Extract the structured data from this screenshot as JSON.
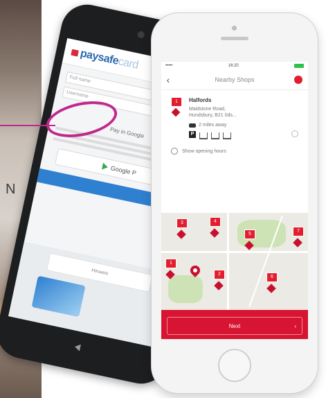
{
  "back_phone": {
    "brand": "paysafe",
    "brand_suffix": "card",
    "fields": [
      "Full name",
      "Username"
    ],
    "pay_text": "Pay in Google",
    "gpay_label": "Google P",
    "bottom_label": "Hinweis"
  },
  "front_phone": {
    "status": {
      "time": "16:20",
      "carrier": "•••••",
      "battery": "100%"
    },
    "header": {
      "title": "Nearby Shops"
    },
    "shop": {
      "number": "1",
      "name": "Halfords",
      "address_line1": "Maidstone Road,",
      "address_line2": "Hundsbury, B21 0ds...",
      "distance": "2 miles away",
      "hours_label": "Show opening hours"
    },
    "map_markers": [
      "3",
      "4",
      "5",
      "7",
      "1",
      "2",
      "6"
    ],
    "next_label": "Next",
    "next_arrow": "›"
  },
  "colors": {
    "accent_red": "#d71432",
    "callout_magenta": "#c0288b"
  }
}
